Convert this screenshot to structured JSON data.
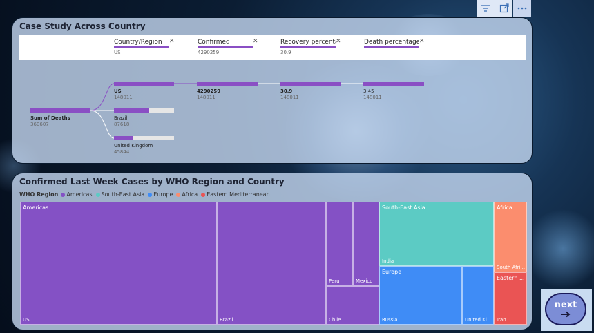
{
  "toolbar": {
    "buttons": [
      {
        "icon": "filter-icon"
      },
      {
        "icon": "focus-mode-icon"
      },
      {
        "icon": "more-options-icon"
      }
    ]
  },
  "decomp": {
    "title": "Case Study Across Country",
    "header": [
      {
        "label": "Country/Region",
        "value": "US"
      },
      {
        "label": "Confirmed",
        "value": "4290259"
      },
      {
        "label": "Recovery percentage",
        "value": "30.9"
      },
      {
        "label": "Death percentage",
        "value": ""
      }
    ],
    "root": {
      "label": "Sum of Deaths",
      "value": "360607",
      "fill": 1.0
    },
    "countries": [
      {
        "label": "US",
        "value": "148011",
        "fill": 1.0
      },
      {
        "label": "Brazil",
        "value": "87618",
        "fill": 0.59
      },
      {
        "label": "United Kingdom",
        "value": "45844",
        "fill": 0.31
      }
    ],
    "chain": [
      {
        "label": "4290259",
        "value": "148011",
        "fill": 1.0
      },
      {
        "label": "30.9",
        "value": "148011",
        "fill": 1.0
      },
      {
        "label": "3.45",
        "value": "148011",
        "fill": 1.0
      }
    ]
  },
  "treemap": {
    "title": "Confirmed Last Week Cases by WHO Region and Country",
    "legend_title": "WHO Region",
    "legend": [
      {
        "name": "Americas",
        "color": "#8451c5"
      },
      {
        "name": "South-East Asia",
        "color": "#5ccbc4"
      },
      {
        "name": "Europe",
        "color": "#3f8cf6"
      },
      {
        "name": "Africa",
        "color": "#fb8d6e"
      },
      {
        "name": "Eastern Mediterranean",
        "color": "#ea5454"
      }
    ],
    "regions": [
      {
        "name": "Americas",
        "color": "#8451c5",
        "countries": [
          "US",
          "Brazil",
          "Chile",
          "Peru",
          "Mexico"
        ]
      },
      {
        "name": "South-East Asia",
        "color": "#5ccbc4",
        "countries": [
          "India"
        ]
      },
      {
        "name": "Europe",
        "color": "#3f8cf6",
        "countries": [
          "Russia",
          "United Ki..."
        ]
      },
      {
        "name": "Africa",
        "color": "#fb8d6e",
        "countries": [
          "South Afri..."
        ]
      },
      {
        "name": "Eastern ...",
        "color": "#ea5454",
        "countries": [
          "Iran"
        ]
      }
    ]
  },
  "next": {
    "label": "next"
  }
}
